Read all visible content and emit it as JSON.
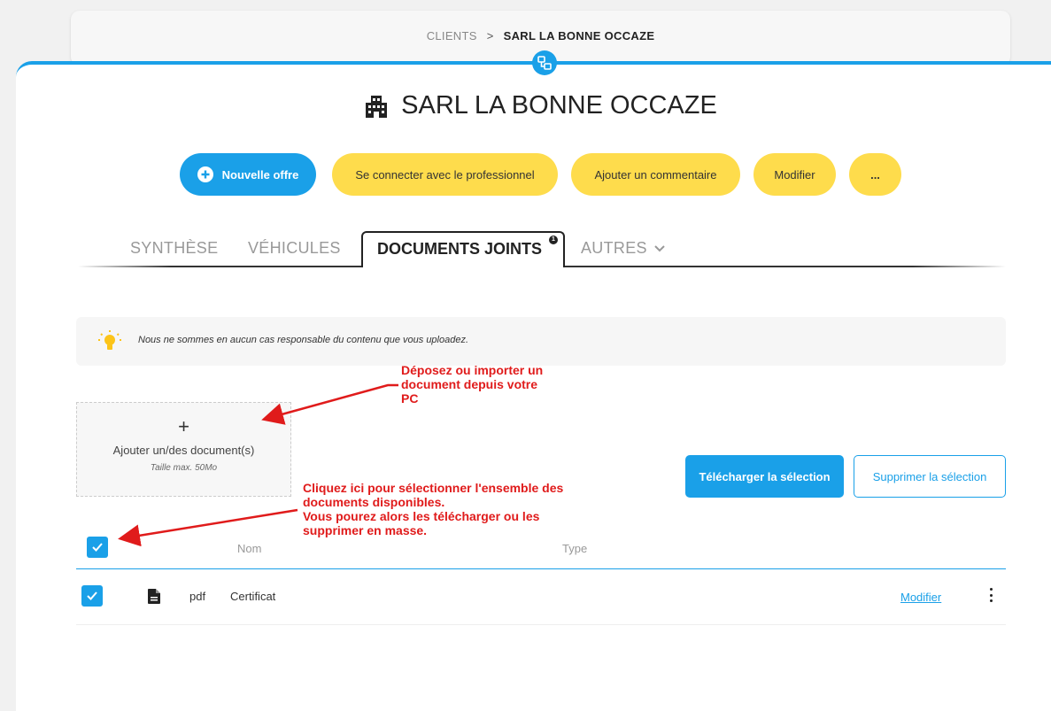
{
  "breadcrumb": {
    "parent": "CLIENTS",
    "separator": ">",
    "current": "SARL LA BONNE OCCAZE"
  },
  "title": "SARL LA BONNE OCCAZE",
  "actions": {
    "new_offer": "Nouvelle offre",
    "connect": "Se connecter avec le professionnel",
    "comment": "Ajouter un commentaire",
    "edit": "Modifier",
    "more": "..."
  },
  "tabs": {
    "synthese": "SYNTHÈSE",
    "vehicules": "VÉHICULES",
    "documents": "DOCUMENTS JOINTS",
    "documents_badge": "1",
    "autres": "AUTRES"
  },
  "notice": "Nous ne sommes en aucun cas responsable du contenu que vous uploadez.",
  "upload": {
    "plus": "+",
    "label": "Ajouter un/des document(s)",
    "hint": "Taille max. 50Mo"
  },
  "bulk": {
    "download": "Télécharger la sélection",
    "delete": "Supprimer la sélection"
  },
  "table": {
    "columns": {
      "name": "Nom",
      "type": "Type"
    },
    "rows": [
      {
        "type": "pdf",
        "name": "Certificat",
        "action": "Modifier"
      }
    ]
  },
  "annotations": {
    "upload": [
      "Déposez ou importer un",
      "document depuis votre",
      "PC"
    ],
    "select": [
      "Cliquez ici pour sélectionner l'ensemble des",
      "documents disponibles.",
      "Vous pourez alors les télécharger ou les",
      "supprimer en masse."
    ]
  },
  "colors": {
    "primary": "#1aa0e8",
    "accent": "#fedc4c",
    "annotation": "#e01b1b"
  }
}
